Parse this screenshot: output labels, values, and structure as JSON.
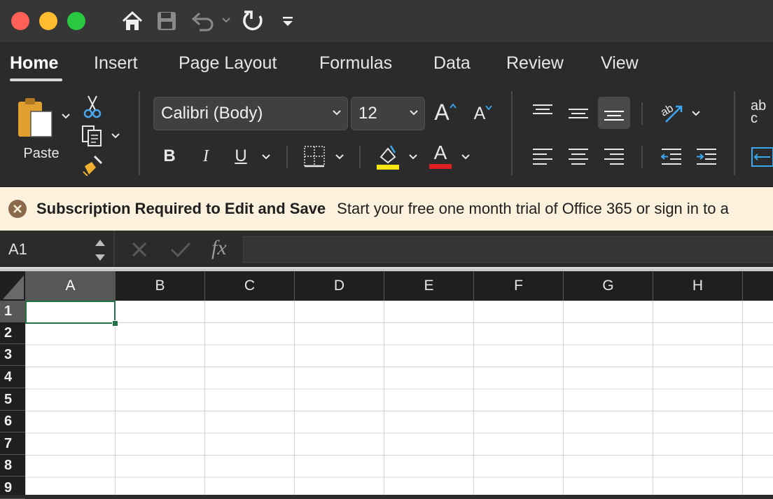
{
  "titlebar": {
    "traffic_colors": [
      "#fe5f57",
      "#febc2e",
      "#28c840"
    ],
    "icons": [
      "home-icon",
      "save-icon",
      "undo-icon",
      "redo-icon",
      "customize-icon"
    ]
  },
  "tabs": [
    {
      "label": "Home",
      "active": true
    },
    {
      "label": "Insert"
    },
    {
      "label": "Page Layout"
    },
    {
      "label": "Formulas"
    },
    {
      "label": "Data"
    },
    {
      "label": "Review"
    },
    {
      "label": "View"
    }
  ],
  "ribbon": {
    "paste_label": "Paste",
    "font_name": "Calibri (Body)",
    "font_size": "12",
    "bold": "B",
    "italic": "I",
    "underline": "U",
    "font_color_letter": "A",
    "grow_letter": "A",
    "shrink_letter": "A",
    "highlight_color": "#f5e614",
    "font_color": "#e02020",
    "accent_blue": "#3ba7f0",
    "ab_label": "ab",
    "c_label": "c"
  },
  "banner": {
    "title": "Subscription Required to Edit and Save",
    "message": "Start your free one month trial of Office 365 or sign in to a"
  },
  "formula_bar": {
    "name_box": "A1",
    "fx_label": "fx",
    "value": ""
  },
  "grid": {
    "columns": [
      "A",
      "B",
      "C",
      "D",
      "E",
      "F",
      "G",
      "H"
    ],
    "rows": [
      "1",
      "2",
      "3",
      "4",
      "5",
      "6",
      "7",
      "8",
      "9"
    ],
    "selected_cell": "A1",
    "selection_color": "#217346"
  }
}
